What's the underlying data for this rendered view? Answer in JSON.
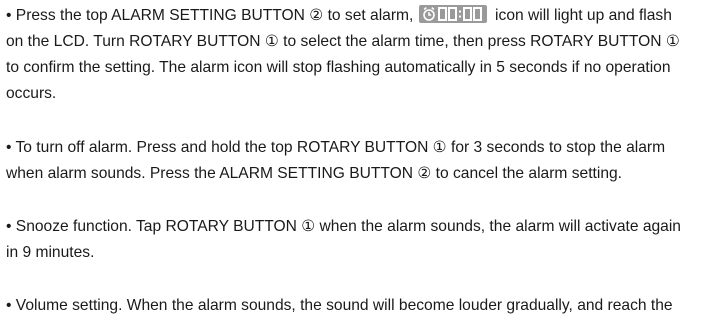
{
  "paragraphs": [
    {
      "lines": [
        "• Press the top ALARM SETTING BUTTON ② to set alarm, ",
        " icon will light up and flash",
        "on the LCD. Turn ROTARY BUTTON ① to select the alarm time, then press ROTARY BUTTON ①",
        "to confirm the setting. The alarm icon will stop flashing automatically in 5 seconds if no operation",
        "occurs."
      ]
    },
    {
      "lines": [
        "• To turn off alarm. Press and hold the top ROTARY BUTTON ① for 3 seconds to stop the alarm",
        "when alarm sounds. Press the ALARM SETTING BUTTON ② to cancel the alarm setting."
      ]
    },
    {
      "lines": [
        "• Snooze function. Tap ROTARY BUTTON ① when the alarm sounds, the alarm will activate again",
        "in 9 minutes."
      ]
    },
    {
      "lines": [
        "• Volume setting. When the alarm sounds, the sound will become louder gradually, and reach the"
      ]
    }
  ],
  "alarm_icon": {
    "name": "alarm-clock-lcd-icon",
    "display_text": "00:00",
    "background": "#9a9a9a",
    "segment_color": "#ffffff"
  }
}
